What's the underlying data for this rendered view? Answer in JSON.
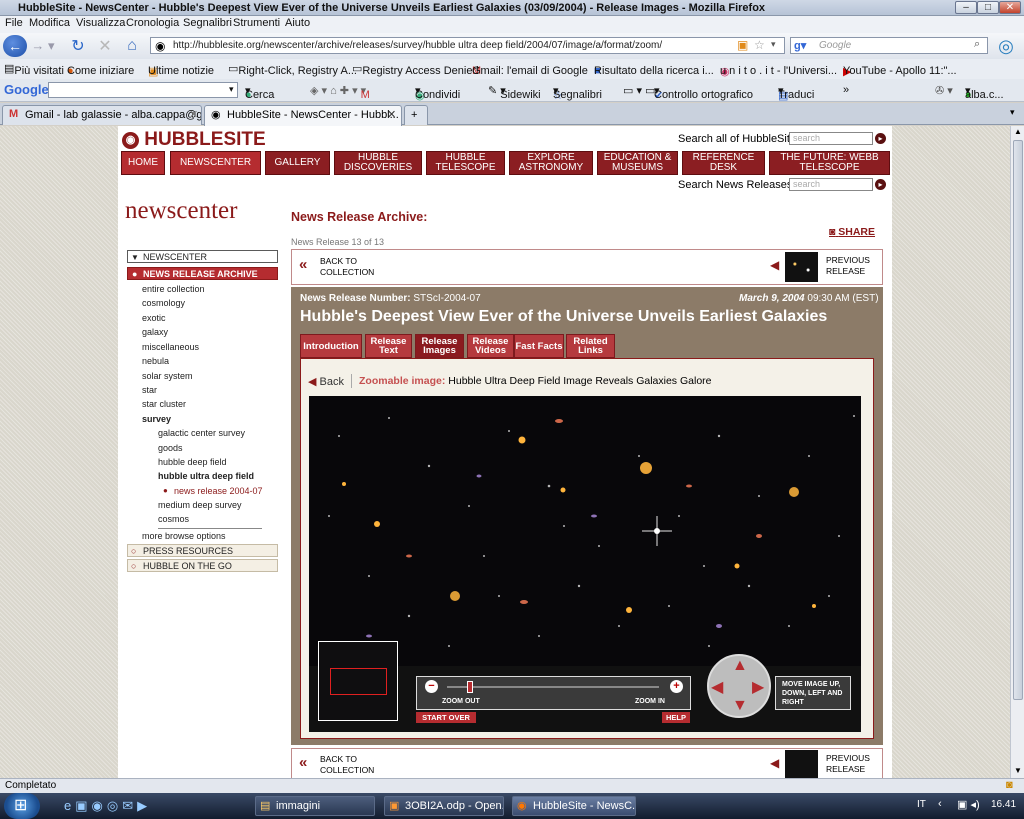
{
  "window": {
    "title": "HubbleSite - NewsCenter - Hubble's Deepest View Ever of the Universe Unveils Earliest Galaxies (03/09/2004) - Release Images - Mozilla Firefox"
  },
  "menu": [
    "File",
    "Modifica",
    "Visualizza",
    "Cronologia",
    "Segnalibri",
    "Strumenti",
    "Aiuto"
  ],
  "nav": {
    "url": "http://hubblesite.org/newscenter/archive/releases/survey/hubble ultra deep field/2004/07/image/a/format/zoom/",
    "search_placeholder": "Google"
  },
  "bookmarks": [
    "Più visitati",
    "Come iniziare",
    "Ultime notizie",
    "Right-Click, Registry A...",
    "Registry Access Denied",
    "Gmail: l'email di Google",
    "Risultato della ricerca i...",
    "u n i t o . i t - l'Universi...",
    "YouTube - Apollo 11:\"..."
  ],
  "googlebar": {
    "logo": "Google",
    "items": [
      "Cerca",
      "Condividi",
      "Sidewiki",
      "Segnalibri",
      "Controllo ortografico",
      "Traduci",
      "»"
    ],
    "user": "alba.c..."
  },
  "tabs": [
    {
      "label": "Gmail - lab galassie - alba.cappa@g..."
    },
    {
      "label": "HubbleSite - NewsCenter - Hubbl..."
    }
  ],
  "site": {
    "logo": "HUBBLESITE",
    "search_all_label": "Search all of HubbleSite",
    "search_placeholder": "search",
    "nav_tabs": [
      "HOME",
      "NEWSCENTER",
      "GALLERY",
      "HUBBLE DISCOVERIES",
      "HUBBLE TELESCOPE",
      "EXPLORE ASTRONOMY",
      "EDUCATION & MUSEUMS",
      "REFERENCE DESK",
      "THE FUTURE: WEBB TELESCOPE"
    ],
    "search_news_label": "Search News Releases",
    "newscenter": "newscenter",
    "archive_title": "News Release Archive:",
    "release_count": "News Release 13 of 13",
    "share": "SHARE",
    "back_to_collection": "BACK TO COLLECTION",
    "previous_release": "PREVIOUS RELEASE",
    "release_number_label": "News Release Number:",
    "release_number": "STScI-2004-07",
    "date": "March 9, 2004",
    "time": "09:30 AM (EST)",
    "headline": "Hubble's Deepest View Ever of the Universe Unveils Earliest Galaxies",
    "release_tabs": [
      "Introduction",
      "Release Text",
      "Release Images",
      "Release Videos",
      "Fast Facts",
      "Related Links"
    ],
    "back": "Back",
    "zoomable_label": "Zoomable image:",
    "zoomable_title": "Hubble Ultra Deep Field Image Reveals Galaxies Galore",
    "zoom_out": "ZOOM OUT",
    "zoom_in": "ZOOM IN",
    "start_over": "START OVER",
    "help": "HELP",
    "move_text": "MOVE IMAGE UP, DOWN, LEFT AND RIGHT"
  },
  "sidebar": {
    "header": "NEWSCENTER",
    "active": "NEWS RELEASE ARCHIVE",
    "items": [
      "entire collection",
      "cosmology",
      "exotic",
      "galaxy",
      "miscellaneous",
      "nebula",
      "solar system",
      "star",
      "star cluster"
    ],
    "survey": "survey",
    "sub": [
      "galactic center survey",
      "goods",
      "hubble deep field"
    ],
    "current": "hubble ultra deep field",
    "current_release": "news release 2004-07",
    "sub2": [
      "medium deep survey",
      "cosmos"
    ],
    "more": "more browse options",
    "boxes": [
      "PRESS RESOURCES",
      "HUBBLE ON THE GO"
    ]
  },
  "status": "Completato",
  "taskbar": {
    "items": [
      "immagini",
      "3OBI2A.odp - Open...",
      "HubbleSite - NewsC..."
    ],
    "lang": "IT",
    "clock": "16.41"
  }
}
